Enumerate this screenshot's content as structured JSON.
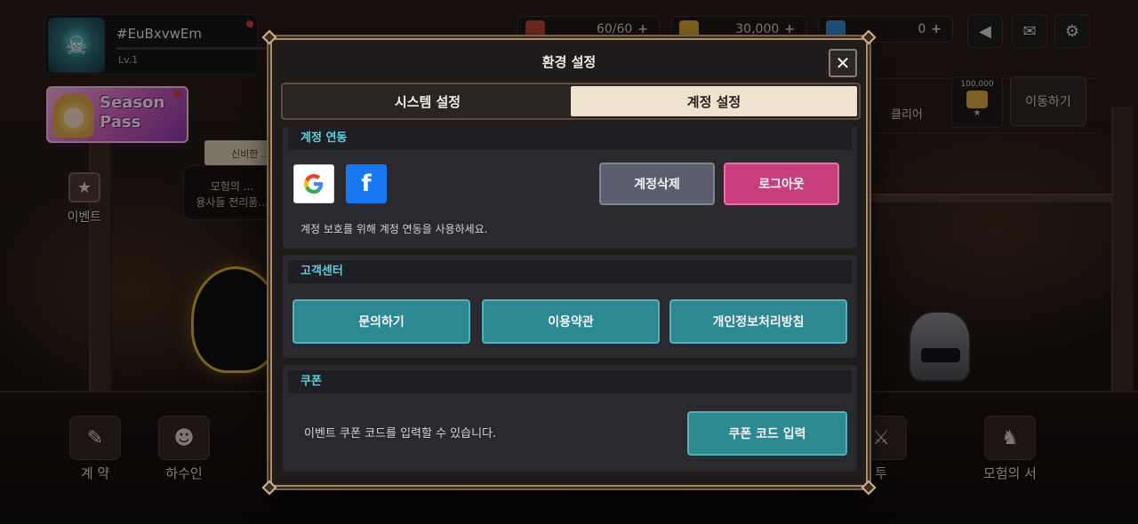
{
  "game_hud": {
    "player_name": "#EuBxvwEm",
    "player_level": "Lv.1",
    "resources": [
      {
        "icon": "energy-icon",
        "value": "60/60",
        "color": "#b8472e"
      },
      {
        "icon": "gold-coin-icon",
        "value": "30,000",
        "color": "#d8a83a"
      },
      {
        "icon": "crystal-icon",
        "value": "0",
        "color": "#3c8ad0"
      }
    ],
    "season_pass_label": "Season Pass",
    "event_label": "이벤트",
    "notice_banner": "신비한 ...",
    "notice_text": "모험의 ...\n용사들 전리품...",
    "right_panel_text": "클리어",
    "reward_amount": "100,000",
    "move_button": "이동하기",
    "bottom_nav": [
      {
        "icon": "contract-scroll-icon",
        "label": "계 약"
      },
      {
        "icon": "imp-face-icon",
        "label": "하수인"
      },
      {
        "icon": "sword-icon",
        "label": "투"
      },
      {
        "icon": "adventure-book-icon",
        "label": "모험의 서"
      }
    ]
  },
  "modal": {
    "title": "환경 설정",
    "tabs": [
      {
        "label": "시스템 설정",
        "active": false
      },
      {
        "label": "계정 설정",
        "active": true
      }
    ],
    "account_link": {
      "header": "계정 연동",
      "google_icon": "google-logo-icon",
      "facebook_icon": "facebook-logo-icon",
      "delete_button": "계정삭제",
      "logout_button": "로그아웃",
      "note": "계정 보호를 위해 계정 연동을 사용하세요."
    },
    "support": {
      "header": "고객센터",
      "buttons": [
        "문의하기",
        "이용약관",
        "개인정보처리방침"
      ]
    },
    "coupon": {
      "header": "쿠폰",
      "description": "이벤트 쿠폰 코드를 입력할 수 있습니다.",
      "button": "쿠폰 코드 입력"
    }
  },
  "colors": {
    "accent_teal": "#2c8893",
    "header_text_teal": "#5fd0dc",
    "logout_pink": "#c83e7c",
    "delete_gray": "#5b5e6e",
    "tab_active": "#efe3d0",
    "frame_gold": "#a58a6c"
  }
}
